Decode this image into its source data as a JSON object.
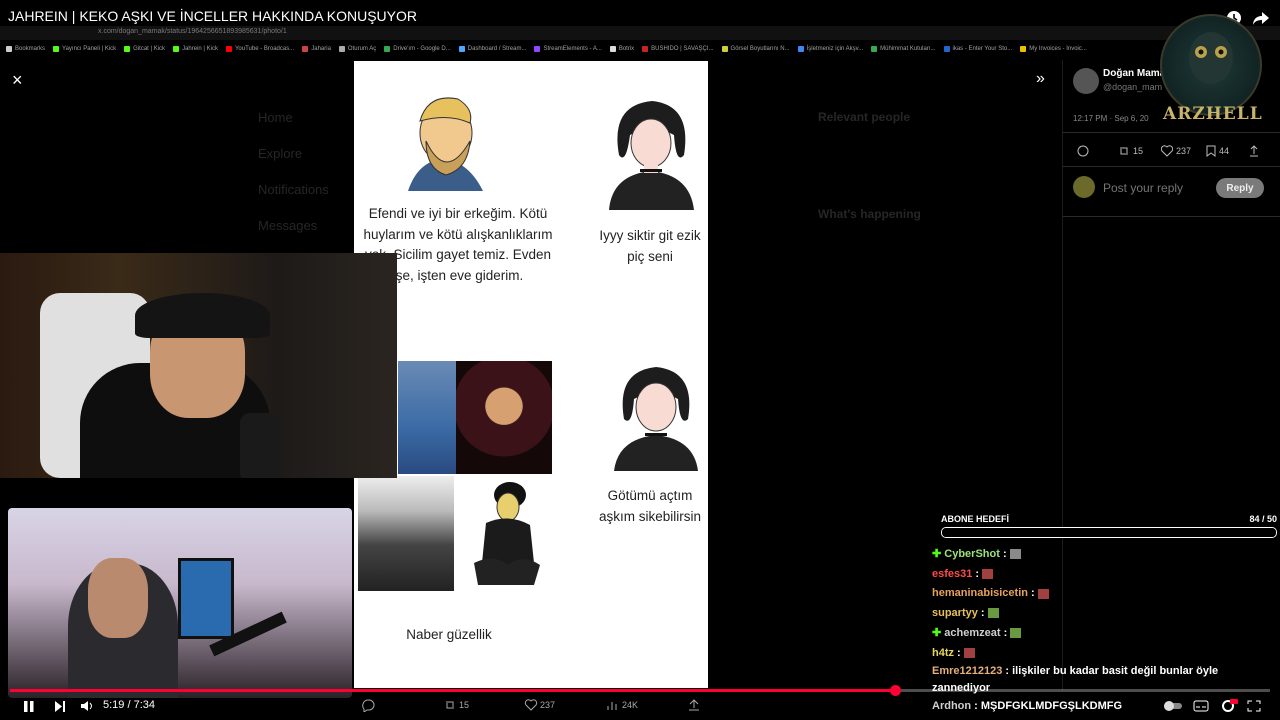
{
  "video": {
    "title": "JAHREIN | KEKO AŞKI VE İNCELLER HAKKINDA KONUŞUYOR",
    "time": "5:19 / 7:34",
    "progress_fraction": 0.702
  },
  "browser": {
    "url": "x.com/dogan_mamak/status/1964256651893985631/photo/1",
    "bookmarks": [
      "Bookmarks",
      "Yayıncı Paneli | Kick",
      "Gitcat | Kick",
      "Jahrein | Kick",
      "YouTube - Broadcas...",
      "Jaharia",
      "Oturum Aç",
      "Drive'ım - Google D...",
      "Dashboard / Stream...",
      "StreamElements - A...",
      "Botrix",
      "BUSHIDO | SAVAŞÇI...",
      "Görsel Boyutlarını N...",
      "İşletmeniz için Akşv...",
      "Mühimmat Kutuları...",
      "ikas - Enter Your Sto...",
      "My Invoices - Invoic..."
    ]
  },
  "x_page": {
    "close_label": "×",
    "expand_label": "»",
    "nav": [
      "Home",
      "Explore",
      "Notifications",
      "Messages"
    ],
    "sidebar_dim": [
      "Relevant people",
      "What's happening"
    ],
    "tweet": {
      "author": "Doğan Mama",
      "handle": "@dogan_mam",
      "timestamp": "12:17 PM · Sep 6, 20",
      "reposts": "15",
      "likes": "237",
      "bookmarks": "44",
      "reply_placeholder": "Post your reply",
      "reply_button": "Reply"
    },
    "image_bar": {
      "reposts": "15",
      "likes": "237",
      "views": "24K"
    }
  },
  "meme": {
    "chad_text": "Efendi ve iyi bir erkeğim. Kötü huylarım ve kötü alışkanlıklarım yok. Sicilim gayet temiz. Evden işe, işten eve giderim.",
    "girl_reply_1": "Iyyy siktir git ezik piç seni",
    "girl_reply_2": "Götümü açtım aşkım sikebilirsin",
    "keko_text": "Naber güzellik"
  },
  "overlay": {
    "logo_text": "ARZHELL",
    "sub_goal_label": "ABONE HEDEFİ",
    "sub_goal_count": "84 / 50",
    "sub_goal_fraction": 1.0
  },
  "chat": [
    {
      "user": "CyberShot",
      "message": "",
      "color": "#9be37a",
      "badge": true
    },
    {
      "user": "esfes31",
      "message": "",
      "color": "#ff4b4b",
      "badge": false
    },
    {
      "user": "hemaninabisicetin",
      "message": "",
      "color": "#e6a35c",
      "badge": false
    },
    {
      "user": "supartyy",
      "message": "",
      "color": "#e6c15c",
      "badge": false
    },
    {
      "user": "achemzeat",
      "message": "",
      "color": "#cfcfcf",
      "badge": true
    },
    {
      "user": "h4tz",
      "message": "",
      "color": "#e6d85c",
      "badge": false
    },
    {
      "user": "Emre1212123",
      "message": "ilişkiler bu kadar basit değil bunlar öyle zannediyor",
      "color": "#e6b07a",
      "badge": false
    },
    {
      "user": "Ardhon",
      "message": "MŞDFGKLMDFGŞLKDMFG",
      "color": "#cfcfcf",
      "badge": false
    }
  ]
}
